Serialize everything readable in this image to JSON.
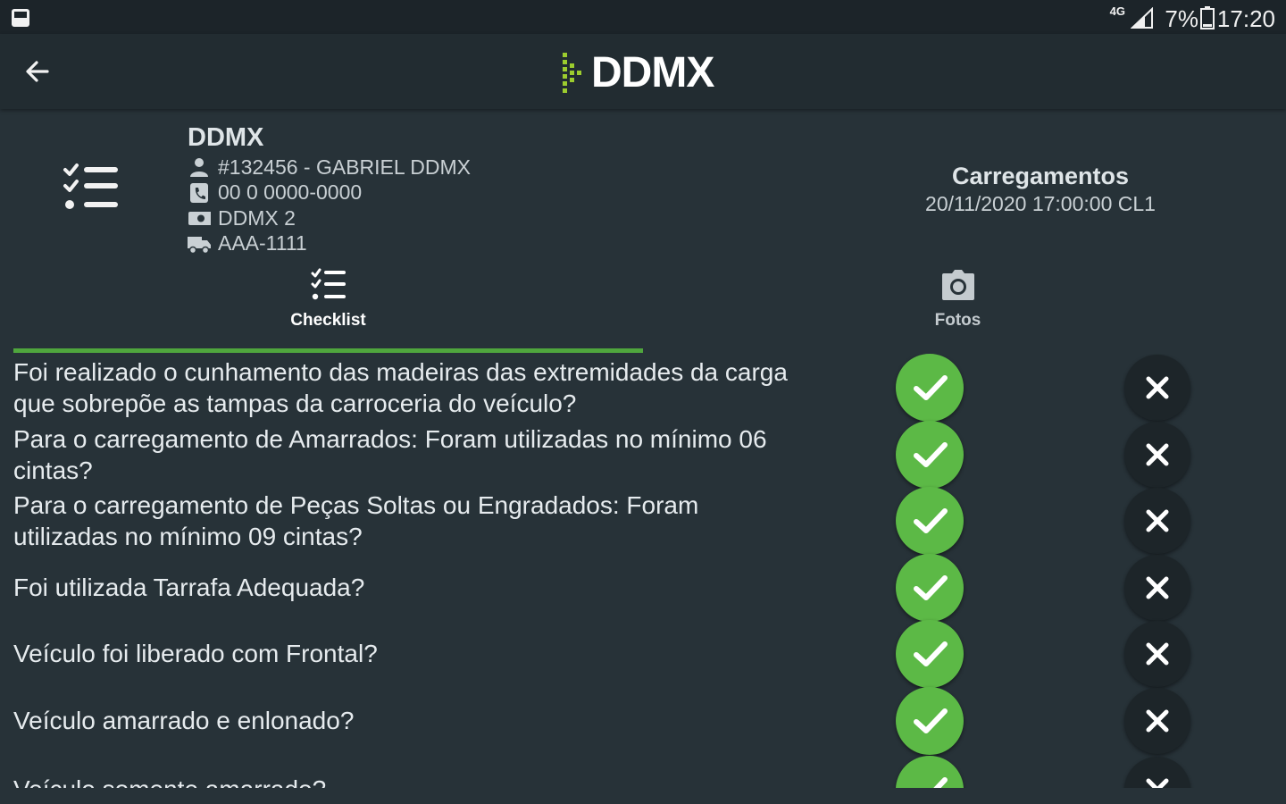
{
  "status_bar": {
    "network": "4G",
    "battery_percent": "7%",
    "time": "17:20"
  },
  "app_bar": {
    "logo_text": "DDMX"
  },
  "info": {
    "company": "DDMX",
    "driver": "#132456 - GABRIEL DDMX",
    "phone": "00 0 0000-0000",
    "carrier": "DDMX 2",
    "plate": "AAA-1111"
  },
  "summary": {
    "title": "Carregamentos",
    "subtitle": "20/11/2020 17:00:00 CL1"
  },
  "tabs": [
    {
      "label": "Checklist",
      "active": true
    },
    {
      "label": "Fotos",
      "active": false
    }
  ],
  "checklist": {
    "questions": [
      "Foi realizado o cunhamento das madeiras das extremidades da carga que sobrepõe as tampas da carroceria do veículo?",
      "Para o carregamento de Amarrados: Foram utilizadas no mínimo 06 cintas?",
      "Para o carregamento de Peças Soltas ou Engradados: Foram utilizadas no mínimo 09 cintas?",
      "Foi utilizada Tarrafa Adequada?",
      "Veículo foi liberado com Frontal?",
      "Veículo amarrado e enlonado?",
      "Veículo somente amarrado?"
    ]
  },
  "colors": {
    "background": "#273238",
    "app_bar": "#222c31",
    "status_bar": "#1c2429",
    "accent_green": "#5cb946",
    "tab_indicator": "#4fa63d",
    "reject_button": "#1d2529",
    "logo_dots": "#9ccc2e"
  },
  "icons": {
    "back": "arrow-left-icon",
    "checklist": "checklist-icon",
    "camera": "camera-icon",
    "person": "person-icon",
    "phone": "phone-icon",
    "carrier": "card-icon",
    "truck": "truck-icon",
    "yes": "check-icon",
    "no": "close-icon"
  }
}
